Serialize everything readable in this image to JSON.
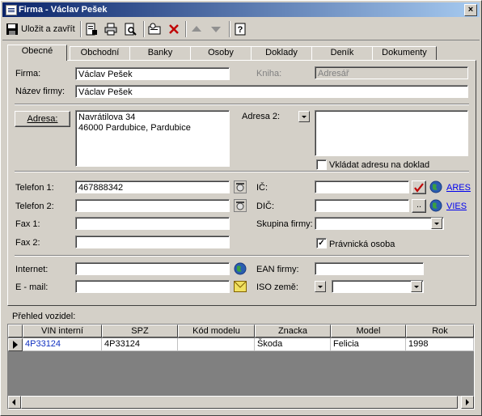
{
  "window": {
    "title": "Firma - Václav Pešek",
    "close_glyph": "×"
  },
  "toolbar": {
    "save_close_label": "Uložit a zavřít",
    "items": [
      "save-icon",
      "print-preview-icon",
      "print-icon",
      "search-icon",
      "address-book-icon",
      "delete-icon",
      "previous-icon",
      "next-icon",
      "help-icon"
    ]
  },
  "tabs": [
    "Obecné",
    "Obchodní",
    "Banky",
    "Osoby",
    "Doklady",
    "Deník",
    "Dokumenty"
  ],
  "active_tab": "Obecné",
  "form": {
    "firma_label": "Firma:",
    "firma_value": "Václav Pešek",
    "kniha_label": "Kniha:",
    "kniha_value": "Adresář",
    "nazev_label": "Název firmy:",
    "nazev_value": "Václav Pešek",
    "adresa_button": "Adresa:",
    "adresa_line1": "Navrátilova 34",
    "adresa_line2": "46000 Pardubice, Pardubice",
    "adresa2_label": "Adresa 2:",
    "adresa2_value": "",
    "vkladat_label": "Vkládat adresu na doklad",
    "vkladat_checked": false,
    "telefon1_label": "Telefon 1:",
    "telefon1_value": "467888342",
    "telefon2_label": "Telefon 2:",
    "telefon2_value": "",
    "fax1_label": "Fax 1:",
    "fax1_value": "",
    "fax2_label": "Fax 2:",
    "fax2_value": "",
    "ic_label": "IČ:",
    "ic_value": "",
    "ares_link": "ARES",
    "dic_label": "DIČ:",
    "dic_value": "",
    "dic_button": "..",
    "vies_link": "VIES",
    "skupina_label": "Skupina firmy:",
    "skupina_value": "",
    "pravnicka_label": "Právnická osoba",
    "pravnicka_checked": true,
    "internet_label": "Internet:",
    "internet_value": "",
    "email_label": "E - mail:",
    "email_value": "",
    "ean_label": "EAN firmy:",
    "ean_value": "",
    "iso_label": "ISO země:",
    "iso_value": ""
  },
  "vehicles": {
    "title": "Přehled vozidel:",
    "columns": [
      "VIN interní",
      "SPZ",
      "Kód modelu",
      "Znacka",
      "Model",
      "Rok"
    ],
    "rows": [
      {
        "vin": "4P33124",
        "spz": "4P33124",
        "kod": "",
        "znacka": "Škoda",
        "model": "Felicia",
        "rok": "1998"
      }
    ]
  },
  "colors": {
    "title_start": "#0a246a",
    "title_end": "#a6caf0",
    "face": "#d4d0c8",
    "link": "#0000ee",
    "vin_text": "#1030c0"
  }
}
